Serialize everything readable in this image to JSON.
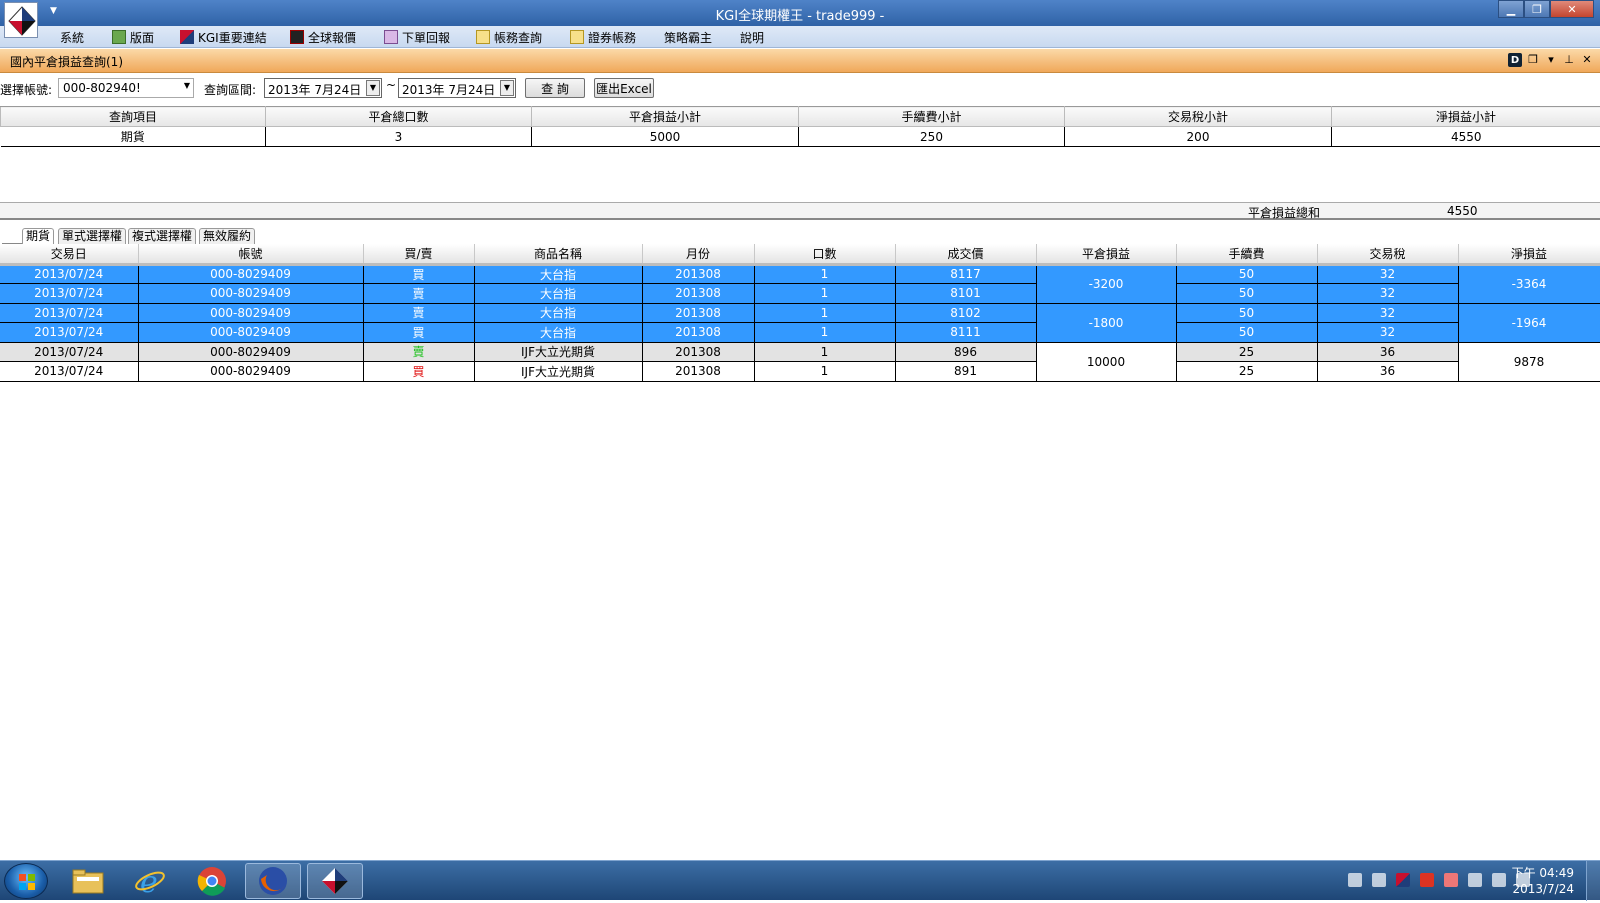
{
  "window": {
    "title": "KGI全球期權王 - trade999 -"
  },
  "menu": [
    "系統",
    "版面",
    "KGI重要連結",
    "全球報價",
    "下單回報",
    "帳務查詢",
    "證券帳務",
    "策略霸主",
    "說明"
  ],
  "panel": {
    "title": "國內平倉損益查詢(1)"
  },
  "query": {
    "account_label": "選擇帳號:",
    "account_value": "000-802940!",
    "range_label": "查詢區間:",
    "date_from": "2013年  7月24日",
    "tilde": "~",
    "date_to": "2013年  7月24日",
    "query_button": "查 詢",
    "export_button": "匯出Excel"
  },
  "summary": {
    "headers": [
      "查詢項目",
      "平倉總口數",
      "平倉損益小計",
      "手續費小計",
      "交易稅小計",
      "淨損益小計"
    ],
    "row": [
      "期貨",
      "3",
      "5000",
      "250",
      "200",
      "4550"
    ],
    "total_label": "平倉損益總和",
    "total_value": "4550"
  },
  "tabs": [
    "期貨",
    "單式選擇權",
    "複式選擇權",
    "無效履約"
  ],
  "detail": {
    "headers": [
      "交易日",
      "帳號",
      "買/賣",
      "商品名稱",
      "月份",
      "口數",
      "成交價",
      "平倉損益",
      "手續費",
      "交易稅",
      "淨損益"
    ],
    "rows": [
      [
        "2013/07/24",
        "000-8029409",
        "買",
        "大台指",
        "201308",
        "1",
        "8117",
        "50",
        "32"
      ],
      [
        "2013/07/24",
        "000-8029409",
        "賣",
        "大台指",
        "201308",
        "1",
        "8101",
        "50",
        "32"
      ],
      [
        "2013/07/24",
        "000-8029409",
        "賣",
        "大台指",
        "201308",
        "1",
        "8102",
        "50",
        "32"
      ],
      [
        "2013/07/24",
        "000-8029409",
        "買",
        "大台指",
        "201308",
        "1",
        "8111",
        "50",
        "32"
      ],
      [
        "2013/07/24",
        "000-8029409",
        "賣",
        "IJF大立光期貨",
        "201308",
        "1",
        "896",
        "25",
        "36"
      ],
      [
        "2013/07/24",
        "000-8029409",
        "買",
        "IJF大立光期貨",
        "201308",
        "1",
        "891",
        "25",
        "36"
      ]
    ],
    "groups": [
      {
        "pnl": "-3200",
        "net": "-3364"
      },
      {
        "pnl": "-1800",
        "net": "-1964"
      },
      {
        "pnl": "10000",
        "net": "9878"
      }
    ]
  },
  "taskbar": {
    "apps": [
      "folder-icon",
      "ie-icon",
      "chrome-icon",
      "firefox-icon",
      "kgi-icon"
    ],
    "clock_time": "下午 04:49",
    "clock_date": "2013/7/24"
  },
  "colors": {
    "selected_row": "#3399ff",
    "panel_header": "#f0a85a",
    "buy_green": "#19c119",
    "sell_red": "#e01010"
  }
}
